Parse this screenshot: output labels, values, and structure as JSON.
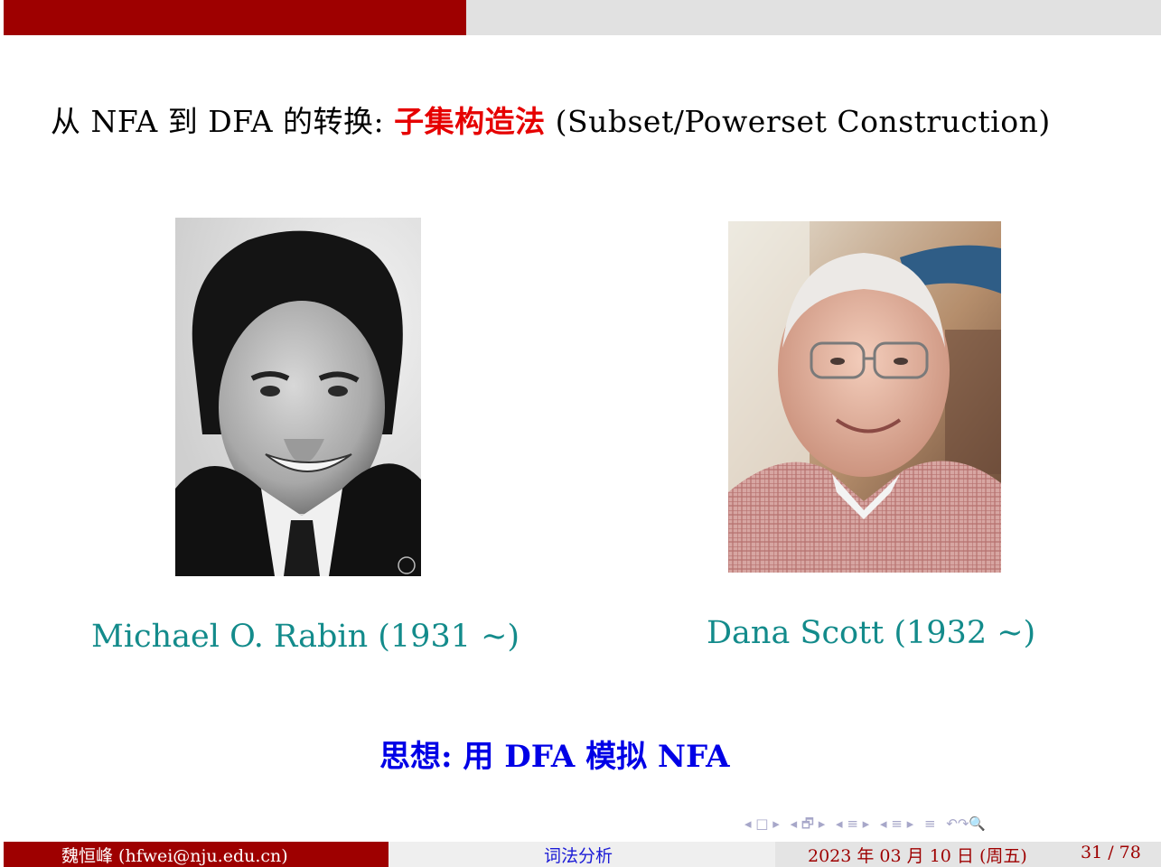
{
  "progress": {
    "fraction": 0.4
  },
  "title": {
    "prefix": "从 NFA 到 DFA 的转换: ",
    "highlight": "子集构造法",
    "suffix": " (Subset/Powerset Construction)"
  },
  "people": [
    {
      "caption": "Michael O. Rabin (1931 ∼)"
    },
    {
      "caption": "Dana Scott (1932 ∼)"
    }
  ],
  "idea": "思想: 用 DFA 模拟 NFA",
  "nav": {
    "frame": "◂ □ ▸",
    "subsection": "◂ 🗗 ▸",
    "section": "◂ ≡ ▸",
    "section_alt": "◂ ≡ ▸",
    "align": "≡",
    "search": "↶↷🔍"
  },
  "footer": {
    "author": "魏恒峰  (hfwei@nju.edu.cn)",
    "topic": "词法分析",
    "date": "2023 年 03 月 10 日 (周五)",
    "page": "31 / 78"
  },
  "colors": {
    "banner": "#9e0000",
    "highlight": "#e60000",
    "caption": "#138b8b",
    "idea": "#0000e6"
  }
}
